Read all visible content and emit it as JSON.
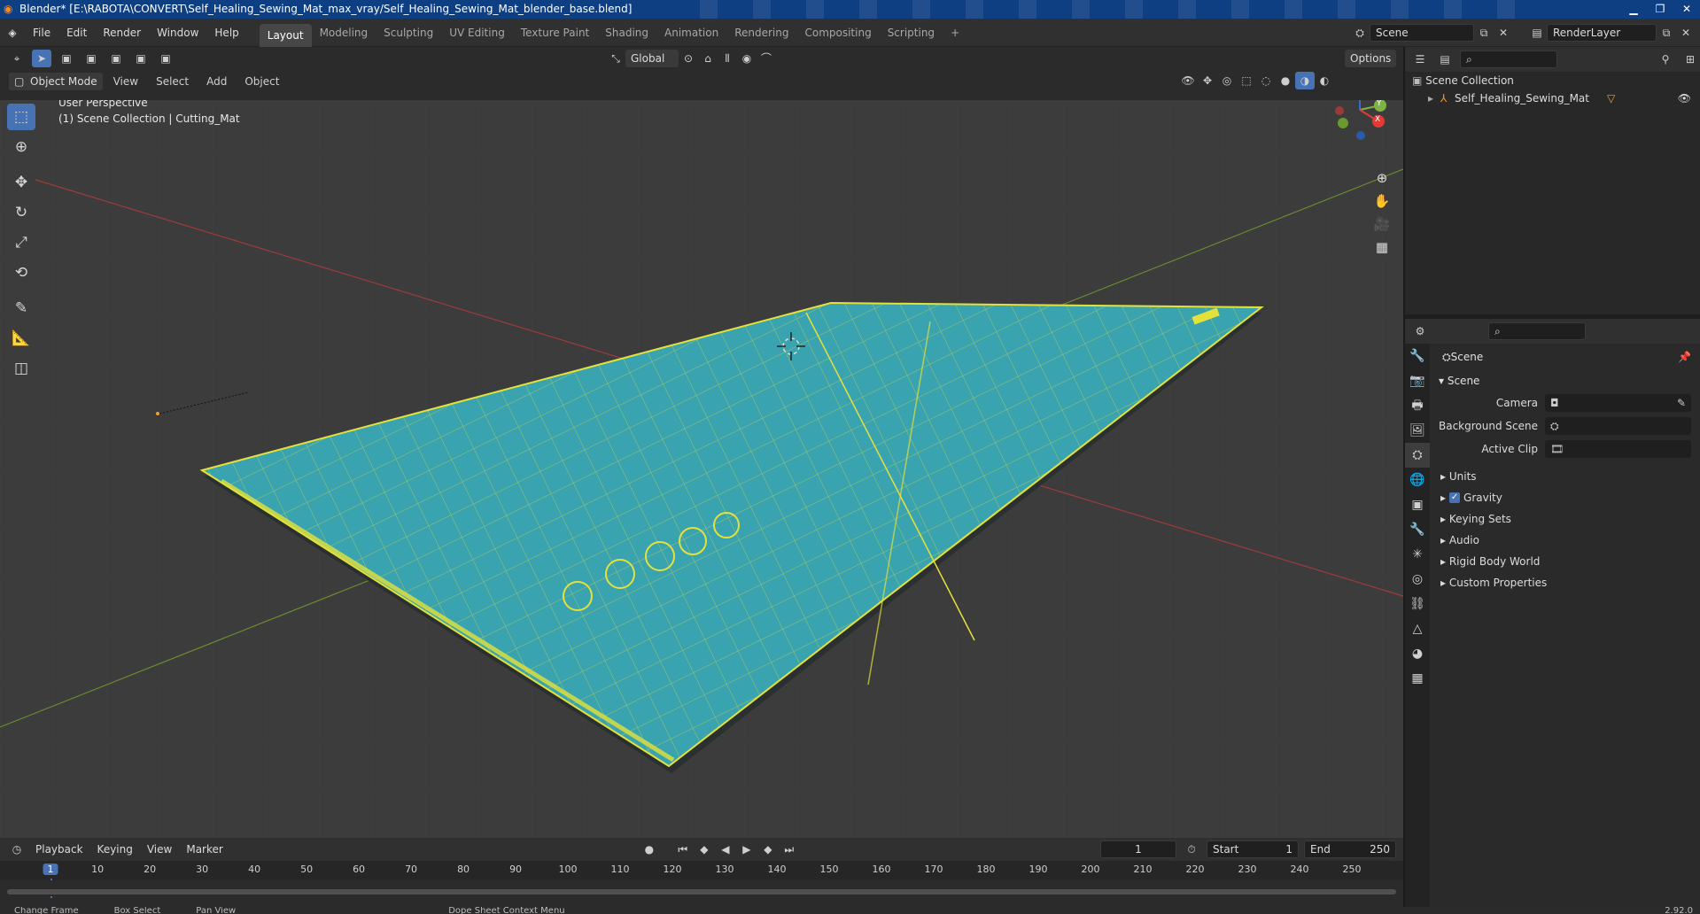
{
  "window": {
    "title": "Blender* [E:\\RABOTA\\CONVERT\\Self_Healing_Sewing_Mat_max_vray/Self_Healing_Sewing_Mat_blender_base.blend]",
    "logo": "blender-logo"
  },
  "menu": [
    "File",
    "Edit",
    "Render",
    "Window",
    "Help"
  ],
  "workspaces": [
    "Layout",
    "Modeling",
    "Sculpting",
    "UV Editing",
    "Texture Paint",
    "Shading",
    "Animation",
    "Rendering",
    "Compositing",
    "Scripting",
    "+"
  ],
  "scene_field": "Scene",
  "renderlayer_field": "RenderLayer",
  "viewport_header": {
    "orientation": "Global",
    "options": "Options",
    "mode": "Object Mode",
    "menus": [
      "View",
      "Select",
      "Add",
      "Object"
    ]
  },
  "viewport_info": {
    "line1": "User Perspective",
    "line2": "(1) Scene Collection | Cutting_Mat"
  },
  "gizmo_axes": {
    "z": "Z",
    "y": "Y",
    "x": "X"
  },
  "outliner": {
    "root": "Scene Collection",
    "item": "Self_Healing_Sewing_Mat"
  },
  "properties": {
    "title": "Scene",
    "section": "Scene",
    "rows": [
      {
        "label": "Camera"
      },
      {
        "label": "Background Scene"
      },
      {
        "label": "Active Clip"
      }
    ],
    "subsections": [
      "Units",
      "Gravity",
      "Keying Sets",
      "Audio",
      "Rigid Body World",
      "Custom Properties"
    ]
  },
  "timeline": {
    "menus": [
      "Playback",
      "Keying",
      "View",
      "Marker"
    ],
    "current_frame": "1",
    "start_label": "Start",
    "start": "1",
    "end_label": "End",
    "end": "250",
    "ticks": [
      "1",
      "10",
      "20",
      "30",
      "40",
      "50",
      "60",
      "70",
      "80",
      "90",
      "100",
      "110",
      "120",
      "130",
      "140",
      "150",
      "160",
      "170",
      "180",
      "190",
      "200",
      "210",
      "220",
      "230",
      "240",
      "250"
    ]
  },
  "statusbar": {
    "items": [
      "Change Frame",
      "Box Select",
      "Pan View",
      "Dope Sheet Context Menu"
    ],
    "version": "2.92.0"
  },
  "colors": {
    "accent": "#4772b3",
    "mat": "#3aa3b0",
    "mat_lines": "#e4e23a",
    "titlebar": "#0f3f83"
  }
}
